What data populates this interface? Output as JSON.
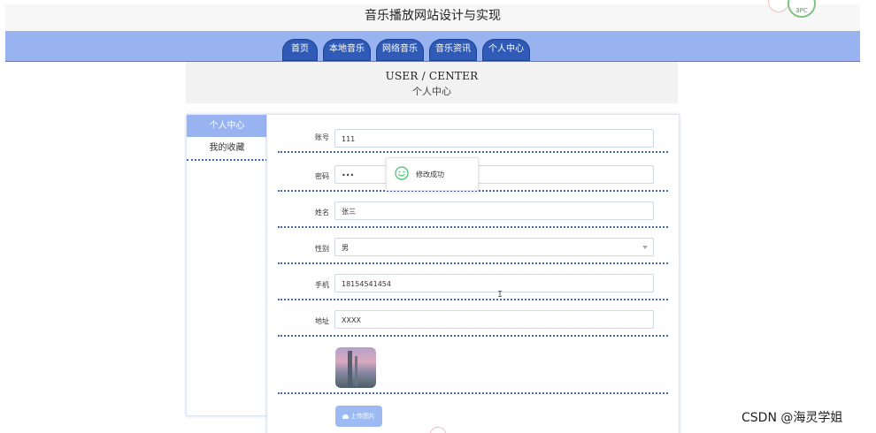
{
  "site": {
    "title": "音乐播放网站设计与实现",
    "weather_label": "3PC"
  },
  "nav": {
    "items": [
      {
        "label": "首页"
      },
      {
        "label": "本地音乐"
      },
      {
        "label": "网络音乐"
      },
      {
        "label": "音乐资讯"
      },
      {
        "label": "个人中心"
      }
    ]
  },
  "hero": {
    "title_en": "USER / CENTER",
    "title_cn": "个人中心"
  },
  "sidebar": {
    "items": [
      {
        "label": "个人中心",
        "active": true
      },
      {
        "label": "我的收藏",
        "active": false
      }
    ]
  },
  "form": {
    "fields": [
      {
        "label": "账号",
        "value": "111"
      },
      {
        "label": "密码",
        "value": "•••"
      },
      {
        "label": "姓名",
        "value": "张三"
      },
      {
        "label": "性别",
        "value": "男"
      },
      {
        "label": "手机",
        "value": "18154541454"
      },
      {
        "label": "地址",
        "value": "XXXX"
      }
    ],
    "upload_label": "上传图片"
  },
  "toast": {
    "message": "修改成功"
  },
  "watermark": {
    "text": "CSDN @海灵学姐"
  },
  "colors": {
    "nav_band": "#99b3f0",
    "nav_item": "#2f5bb7",
    "divider": "#3f68c2",
    "upload_btn": "#9ebaf2"
  },
  "icons": {
    "toast": "smile-icon",
    "upload": "cloud-upload-icon",
    "select": "chevron-down-icon"
  }
}
